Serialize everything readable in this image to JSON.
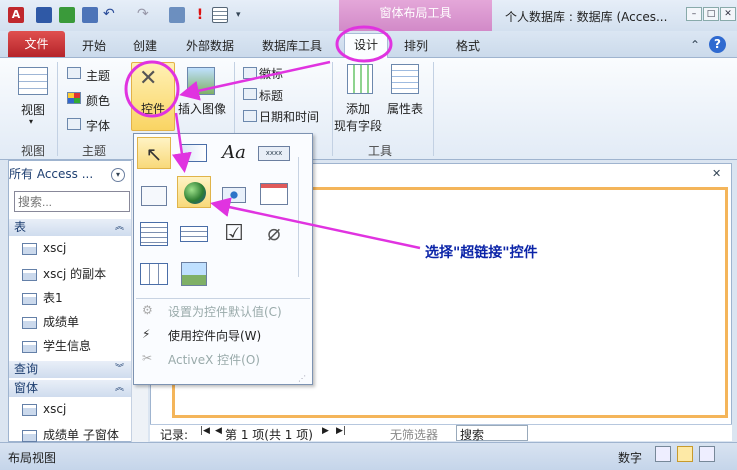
{
  "contextual_tab": {
    "title": "窗体布局工具"
  },
  "window": {
    "title": "个人数据库 : 数据库 (Acces..."
  },
  "tabs": {
    "file": "文件",
    "home": "开始",
    "create": "创建",
    "external": "外部数据",
    "dbtools": "数据库工具",
    "design": "设计",
    "arrange": "排列",
    "format": "格式"
  },
  "ribbon": {
    "view": {
      "label": "视图",
      "group": "视图"
    },
    "theme": {
      "item1": "主题",
      "item2": "颜色",
      "item3": "字体",
      "group": "主题"
    },
    "controls": {
      "label": "控件",
      "insert_image": "插入图像"
    },
    "header": {
      "logo": "徽标",
      "title": "标题",
      "datetime": "日期和时间"
    },
    "tools": {
      "add_field1": "添加",
      "add_field2": "现有字段",
      "props": "属性表",
      "group": "工具"
    }
  },
  "nav": {
    "header": "所有 Access ...",
    "search_placeholder": "搜索...",
    "sections": {
      "tables": "表",
      "queries": "查询",
      "forms": "窗体"
    },
    "tables": [
      "xscj",
      "xscj 的副本",
      "表1",
      "成绩单",
      "学生信息"
    ],
    "forms": [
      "xscj",
      "成绩单 子窗体"
    ]
  },
  "popup": {
    "menu": {
      "set_default": "设置为控件默认值(C)",
      "wizard": "使用控件向导(W)",
      "activex": "ActiveX 控件(O)"
    },
    "aa": "Aa",
    "xxxx": "xxxx"
  },
  "record_bar": {
    "label": "记录:",
    "position": "第 1 项(共 1 项)",
    "filter": "无筛选器",
    "search": "搜索"
  },
  "status": {
    "view": "布局视图",
    "mode": "数字"
  },
  "annotation": {
    "callout": "选择\"超链接\"控件"
  },
  "colors": {
    "accent": "#e033e0",
    "file_tab": "#c8302f",
    "context": "#d28ac8",
    "callout": "#0b24a8"
  }
}
